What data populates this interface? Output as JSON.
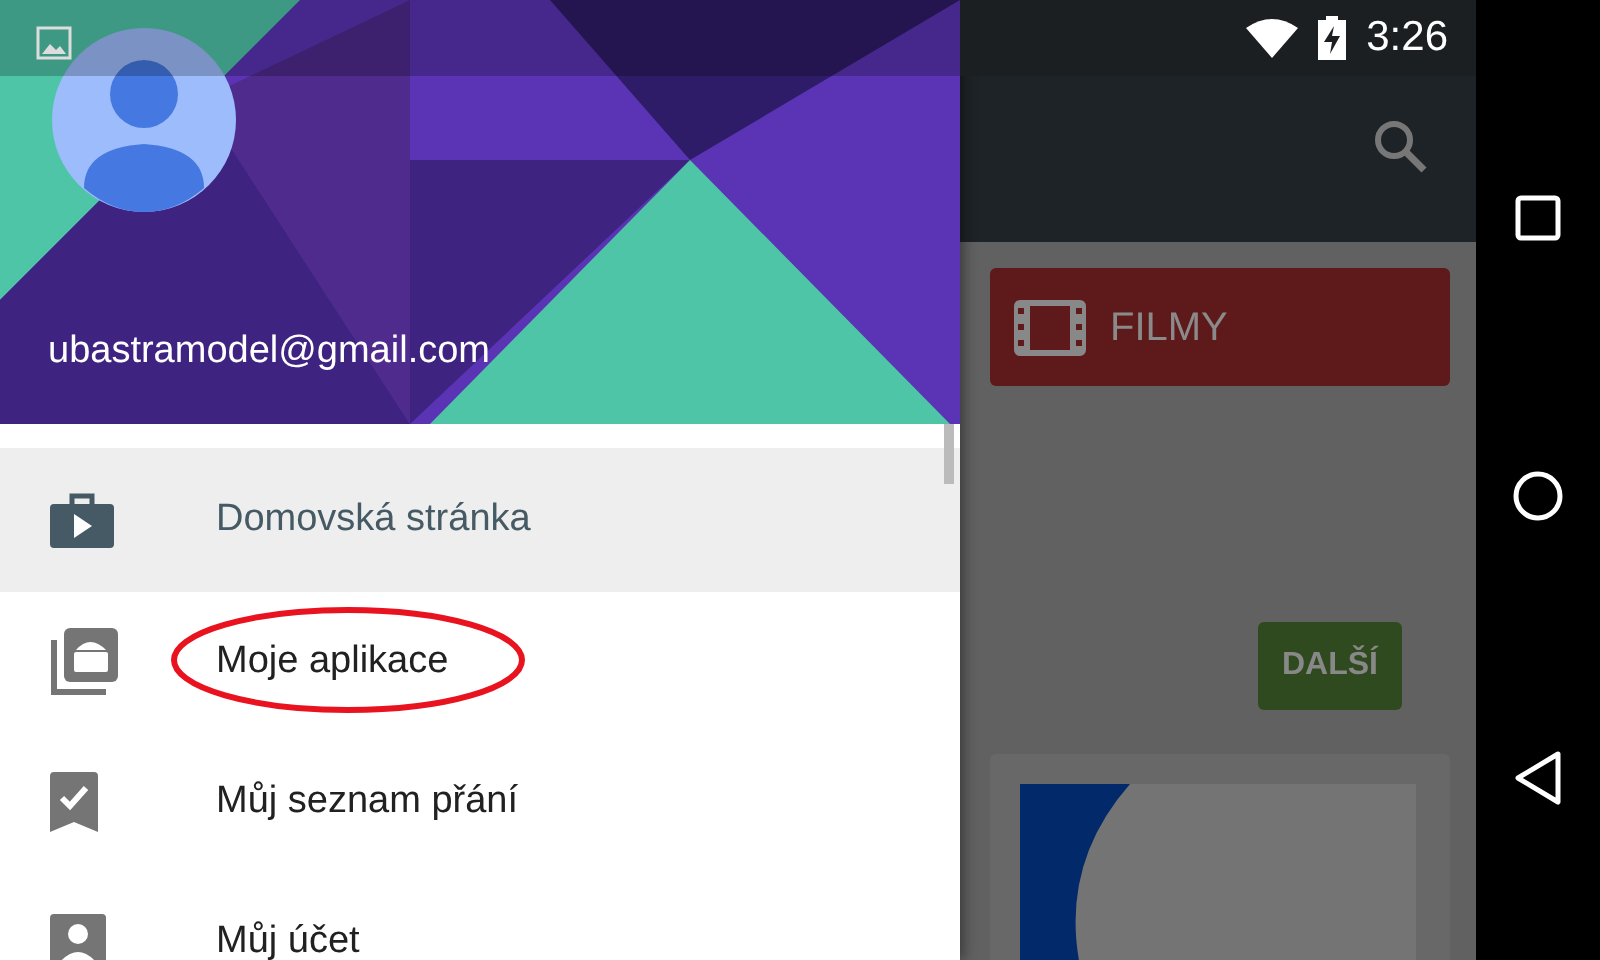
{
  "status_bar": {
    "time": "3:26"
  },
  "drawer": {
    "account_email": "ubastramodel@gmail.com",
    "items": [
      {
        "label": "Domovská stránka",
        "selected": true,
        "circled": false
      },
      {
        "label": "Moje aplikace",
        "selected": false,
        "circled": true
      },
      {
        "label": "Můj seznam přání",
        "selected": false,
        "circled": false
      },
      {
        "label": "Můj účet",
        "selected": false,
        "circled": false
      }
    ]
  },
  "content": {
    "category_tile": {
      "label": "FILMY"
    },
    "more_button": "DALŠÍ"
  }
}
